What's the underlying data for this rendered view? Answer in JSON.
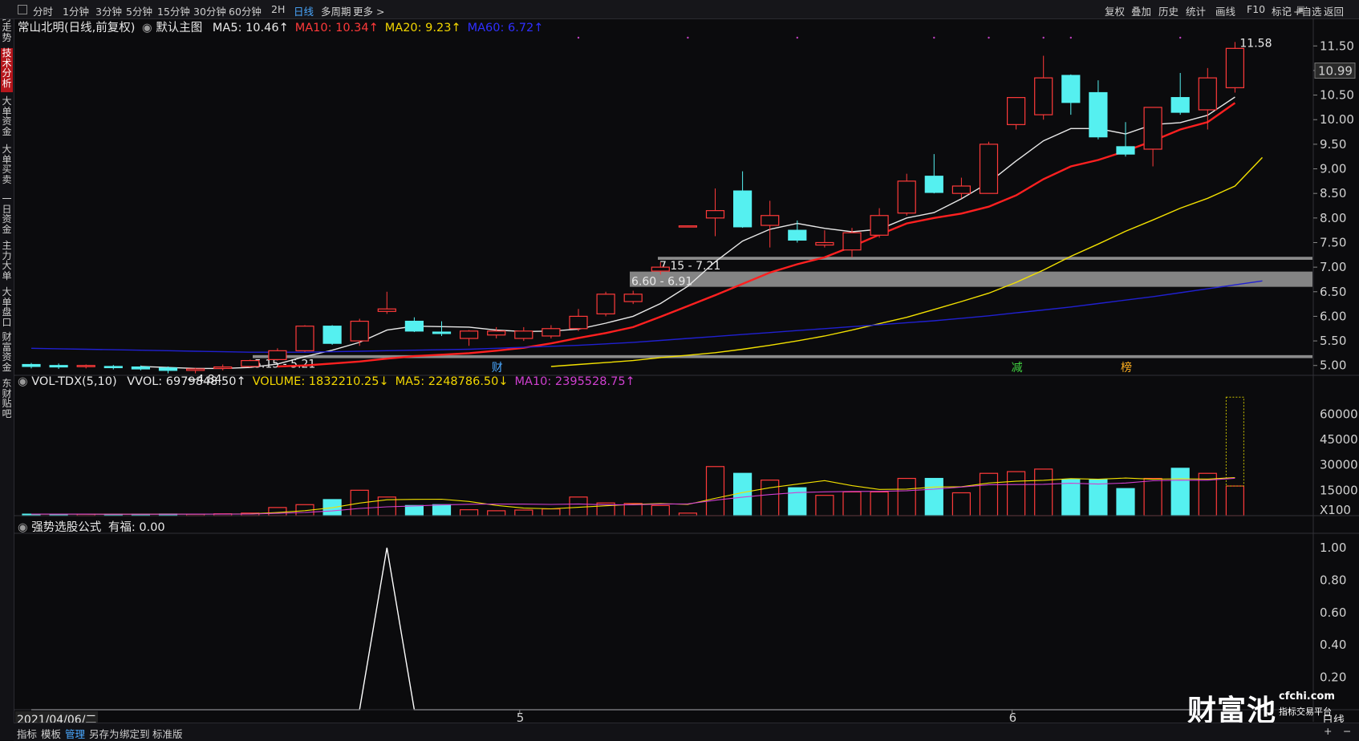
{
  "toolbar": {
    "timeframes": [
      "分时",
      "1分钟",
      "3分钟",
      "5分钟",
      "15分钟",
      "30分钟",
      "60分钟",
      "2H",
      "日线",
      "多周期",
      "更多 >"
    ],
    "active_timeframe": "日线",
    "right_tools": [
      "复权",
      "叠加",
      "历史",
      "统计",
      "画线",
      "F10",
      "标记",
      "+自选",
      "返回"
    ]
  },
  "sidebar": {
    "items": [
      "分时走势",
      "技术分析",
      "大单资金",
      "大单买卖",
      "一日资金",
      "主力大单",
      "大单盘口",
      "财富资金",
      "东财贴吧"
    ],
    "active": "技术分析"
  },
  "main_panel": {
    "stock_name": "常山北明(日线,前复权)",
    "template": "默认主图",
    "indicators": [
      {
        "label": "MA5: 10.46↑",
        "color": "#e8e8e8"
      },
      {
        "label": "MA10: 10.34↑",
        "color": "#ff3a3a"
      },
      {
        "label": "MA20: 9.23↑",
        "color": "#f2d600"
      },
      {
        "label": "MA60: 6.72↑",
        "color": "#2f2fff"
      }
    ],
    "price_ticks": [
      "11.50",
      "11.00",
      "10.50",
      "10.00",
      "9.50",
      "9.00",
      "8.50",
      "8.00",
      "7.50",
      "7.00",
      "6.50",
      "6.00",
      "5.50",
      "5.00"
    ],
    "current_price_tag": "10.99",
    "annotations": {
      "high": "11.58",
      "low": "←4.84",
      "zone1": "5.15 - 5.21",
      "zone2": "6.60 - 6.91",
      "zone3": "7.15 - 7.21"
    },
    "event_markers": [
      "财",
      "减",
      "榜"
    ]
  },
  "volume_panel": {
    "title": "VOL-TDX(5,10)",
    "indicators": [
      {
        "label": "VVOL: 6979848.50↑",
        "color": "#e8e8e8"
      },
      {
        "label": "VOLUME: 1832210.25↓",
        "color": "#f2d600"
      },
      {
        "label": "MA5: 2248786.50↓",
        "color": "#f2d600"
      },
      {
        "label": "MA10: 2395528.75↑",
        "color": "#d040d0"
      }
    ],
    "ticks": [
      "60000",
      "45000",
      "30000",
      "15000"
    ],
    "unit": "X100"
  },
  "formula_panel": {
    "title": "强势选股公式",
    "value_label": "有福: 0.00",
    "ticks": [
      "1.00",
      "0.80",
      "0.60",
      "0.40",
      "0.20"
    ]
  },
  "date_axis": {
    "start_date": "2021/04/06/二",
    "month_labels": [
      "5",
      "6"
    ],
    "period_label": "日线"
  },
  "bottom_tabs": [
    "指标",
    "模板",
    "管理",
    "另存为",
    "绑定到",
    "标准版"
  ],
  "active_bottom_tab": "管理",
  "watermark": {
    "brand": "财富池",
    "domain": "cfchi.com",
    "slogan": "指标交易平台"
  },
  "colors": {
    "up": "#ff3a3a",
    "down": "#55f0f0",
    "ma5": "#e8e8e8",
    "ma10": "#ff2020",
    "ma20": "#f2e000",
    "ma60": "#2020d0",
    "background": "#0b0b0d"
  },
  "chart_data": [
    {
      "type": "candlestick",
      "title": "常山北明(日线,前复权)",
      "ylim": [
        4.8,
        11.7
      ],
      "candles": [
        {
          "o": 5.02,
          "h": 5.05,
          "l": 4.94,
          "c": 4.98
        },
        {
          "o": 5.0,
          "h": 5.04,
          "l": 4.93,
          "c": 4.97
        },
        {
          "o": 4.99,
          "h": 5.02,
          "l": 4.94,
          "c": 5.0
        },
        {
          "o": 4.98,
          "h": 5.01,
          "l": 4.92,
          "c": 4.96
        },
        {
          "o": 4.97,
          "h": 5.0,
          "l": 4.9,
          "c": 4.93
        },
        {
          "o": 4.95,
          "h": 4.98,
          "l": 4.84,
          "c": 4.9
        },
        {
          "o": 4.9,
          "h": 4.95,
          "l": 4.84,
          "c": 4.93
        },
        {
          "o": 4.94,
          "h": 5.02,
          "l": 4.9,
          "c": 4.97
        },
        {
          "o": 4.98,
          "h": 5.12,
          "l": 4.96,
          "c": 5.1
        },
        {
          "o": 5.12,
          "h": 5.35,
          "l": 5.1,
          "c": 5.3
        },
        {
          "o": 5.3,
          "h": 5.82,
          "l": 5.28,
          "c": 5.8
        },
        {
          "o": 5.8,
          "h": 5.82,
          "l": 5.42,
          "c": 5.45
        },
        {
          "o": 5.5,
          "h": 5.95,
          "l": 5.4,
          "c": 5.9
        },
        {
          "o": 6.1,
          "h": 6.5,
          "l": 6.05,
          "c": 6.15
        },
        {
          "o": 5.9,
          "h": 5.98,
          "l": 5.68,
          "c": 5.7
        },
        {
          "o": 5.68,
          "h": 5.9,
          "l": 5.6,
          "c": 5.65
        },
        {
          "o": 5.55,
          "h": 5.72,
          "l": 5.4,
          "c": 5.7
        },
        {
          "o": 5.62,
          "h": 5.78,
          "l": 5.55,
          "c": 5.7
        },
        {
          "o": 5.55,
          "h": 5.78,
          "l": 5.5,
          "c": 5.7
        },
        {
          "o": 5.6,
          "h": 5.82,
          "l": 5.55,
          "c": 5.75
        },
        {
          "o": 5.75,
          "h": 6.15,
          "l": 5.7,
          "c": 6.0
        },
        {
          "o": 6.05,
          "h": 6.5,
          "l": 6.0,
          "c": 6.45
        },
        {
          "o": 6.3,
          "h": 6.52,
          "l": 6.25,
          "c": 6.45
        },
        {
          "o": 6.92,
          "h": 7.1,
          "l": 6.85,
          "c": 7.0
        },
        {
          "o": 7.83,
          "h": 7.85,
          "l": 7.82,
          "c": 7.84
        },
        {
          "o": 8.0,
          "h": 8.6,
          "l": 7.63,
          "c": 8.15
        },
        {
          "o": 8.55,
          "h": 8.95,
          "l": 7.8,
          "c": 7.82
        },
        {
          "o": 7.85,
          "h": 8.35,
          "l": 7.4,
          "c": 8.05
        },
        {
          "o": 7.75,
          "h": 7.95,
          "l": 7.5,
          "c": 7.55
        },
        {
          "o": 7.45,
          "h": 7.75,
          "l": 7.4,
          "c": 7.5
        },
        {
          "o": 7.35,
          "h": 7.8,
          "l": 7.2,
          "c": 7.7
        },
        {
          "o": 7.65,
          "h": 8.2,
          "l": 7.6,
          "c": 8.05
        },
        {
          "o": 8.1,
          "h": 8.9,
          "l": 8.05,
          "c": 8.75
        },
        {
          "o": 8.85,
          "h": 9.3,
          "l": 8.5,
          "c": 8.52
        },
        {
          "o": 8.5,
          "h": 8.82,
          "l": 8.4,
          "c": 8.65
        },
        {
          "o": 8.5,
          "h": 9.55,
          "l": 8.5,
          "c": 9.5
        },
        {
          "o": 9.9,
          "h": 10.45,
          "l": 9.8,
          "c": 10.45
        },
        {
          "o": 10.1,
          "h": 11.3,
          "l": 10.0,
          "c": 10.85
        },
        {
          "o": 10.9,
          "h": 10.92,
          "l": 10.1,
          "c": 10.35
        },
        {
          "o": 10.55,
          "h": 10.8,
          "l": 9.6,
          "c": 9.65
        },
        {
          "o": 9.45,
          "h": 9.95,
          "l": 9.25,
          "c": 9.3
        },
        {
          "o": 9.4,
          "h": 10.25,
          "l": 9.05,
          "c": 10.25
        },
        {
          "o": 10.45,
          "h": 10.95,
          "l": 10.1,
          "c": 10.15
        },
        {
          "o": 10.2,
          "h": 11.05,
          "l": 9.8,
          "c": 10.85
        },
        {
          "o": 10.65,
          "h": 11.58,
          "l": 10.55,
          "c": 11.45
        }
      ],
      "ma_series": [
        {
          "name": "MA5",
          "color": "#e8e8e8",
          "values": [
            null,
            null,
            null,
            null,
            4.98,
            4.96,
            4.94,
            4.94,
            4.96,
            5.03,
            5.18,
            5.31,
            5.47,
            5.72,
            5.8,
            5.79,
            5.78,
            5.72,
            5.69,
            5.7,
            5.74,
            5.86,
            6.0,
            6.26,
            6.61,
            7.11,
            7.53,
            7.77,
            7.89,
            7.79,
            7.72,
            7.77,
            8.0,
            8.11,
            8.39,
            8.72,
            9.16,
            9.57,
            9.82,
            9.82,
            9.71,
            9.9,
            9.94,
            10.09,
            10.46
          ]
        },
        {
          "name": "MA10",
          "color": "#ff2020",
          "values": [
            null,
            null,
            null,
            null,
            null,
            null,
            null,
            null,
            null,
            4.98,
            5.0,
            5.04,
            5.08,
            5.14,
            5.19,
            5.22,
            5.25,
            5.3,
            5.36,
            5.45,
            5.56,
            5.66,
            5.78,
            5.99,
            6.21,
            6.43,
            6.66,
            6.89,
            7.06,
            7.2,
            7.42,
            7.66,
            7.89,
            8.0,
            8.09,
            8.23,
            8.46,
            8.79,
            9.05,
            9.18,
            9.36,
            9.57,
            9.8,
            9.95,
            10.34
          ]
        },
        {
          "name": "MA20",
          "color": "#f2e000",
          "values": [
            null,
            null,
            null,
            null,
            null,
            null,
            null,
            null,
            null,
            null,
            null,
            null,
            null,
            null,
            null,
            null,
            null,
            null,
            null,
            4.98,
            5.02,
            5.06,
            5.1,
            5.16,
            5.21,
            5.26,
            5.33,
            5.41,
            5.5,
            5.6,
            5.72,
            5.85,
            5.98,
            6.14,
            6.3,
            6.47,
            6.69,
            6.94,
            7.22,
            7.47,
            7.73,
            7.96,
            8.2,
            8.4,
            8.65,
            9.23
          ]
        },
        {
          "name": "MA60",
          "color": "#2020d0",
          "values": [
            5.35,
            5.34,
            5.33,
            5.32,
            5.31,
            5.3,
            5.29,
            5.28,
            5.27,
            5.27,
            5.27,
            5.28,
            5.29,
            5.3,
            5.31,
            5.32,
            5.33,
            5.35,
            5.37,
            5.39,
            5.41,
            5.44,
            5.47,
            5.51,
            5.55,
            5.59,
            5.63,
            5.67,
            5.71,
            5.75,
            5.79,
            5.83,
            5.87,
            5.91,
            5.96,
            6.01,
            6.07,
            6.13,
            6.19,
            6.26,
            6.33,
            6.4,
            6.48,
            6.56,
            6.64,
            6.72
          ]
        }
      ],
      "horizontal_zones": [
        {
          "label": "7.15 - 7.21",
          "low": 7.15,
          "high": 7.21
        },
        {
          "label": "6.60 - 6.91",
          "low": 6.6,
          "high": 6.91
        },
        {
          "label": "5.15 - 5.21",
          "low": 5.15,
          "high": 5.21
        }
      ]
    },
    {
      "type": "bar",
      "title": "VOL-TDX(5,10)",
      "unit": "X100",
      "ylim": [
        0,
        72000
      ],
      "values": [
        900,
        850,
        900,
        800,
        900,
        950,
        900,
        1100,
        1500,
        4800,
        6500,
        9500,
        15000,
        11000,
        6000,
        6500,
        3500,
        2900,
        3300,
        4000,
        11000,
        7500,
        7200,
        6000,
        1500,
        29000,
        25000,
        21000,
        16500,
        12000,
        14000,
        14000,
        22000,
        22000,
        13500,
        25000,
        26000,
        27500,
        21500,
        21500,
        16000,
        22000,
        28000,
        25000,
        17500
      ],
      "ma5_values": [
        900,
        880,
        880,
        870,
        870,
        880,
        890,
        930,
        1050,
        1830,
        2960,
        4670,
        7460,
        9360,
        9600,
        9700,
        8400,
        6080,
        4440,
        4040,
        4940,
        5840,
        6660,
        7140,
        6640,
        10240,
        13640,
        16500,
        18600,
        20700,
        17700,
        15500,
        15700,
        16900,
        17100,
        19300,
        20300,
        20900,
        21900,
        21500,
        22200,
        21500,
        21800,
        21600,
        22480
      ],
      "ma10_values": [
        900,
        880,
        880,
        870,
        870,
        870,
        880,
        890,
        930,
        1350,
        1910,
        2800,
        4250,
        5230,
        5740,
        6330,
        6740,
        6880,
        6810,
        6630,
        6920,
        6430,
        6460,
        6820,
        6970,
        9120,
        10930,
        12450,
        13620,
        14050,
        14300,
        14340,
        14750,
        15640,
        16920,
        18300,
        18400,
        18500,
        19150,
        18650,
        19300,
        20600,
        21000,
        20950,
        22100
      ],
      "series_up_down": "up=hollow red, down=cyan filled"
    },
    {
      "type": "line",
      "title": "强势选股公式",
      "ylim": [
        0,
        1.0
      ],
      "values": [
        0,
        0,
        0,
        0,
        0,
        0,
        0,
        0,
        0,
        0,
        0,
        0,
        0,
        1,
        0,
        0,
        0,
        0,
        0,
        0,
        0,
        0,
        0,
        0,
        0,
        0,
        0,
        0,
        0,
        0,
        0,
        0,
        0,
        0,
        0,
        0,
        0,
        0,
        0,
        0,
        0,
        0,
        0,
        0,
        0
      ]
    }
  ]
}
